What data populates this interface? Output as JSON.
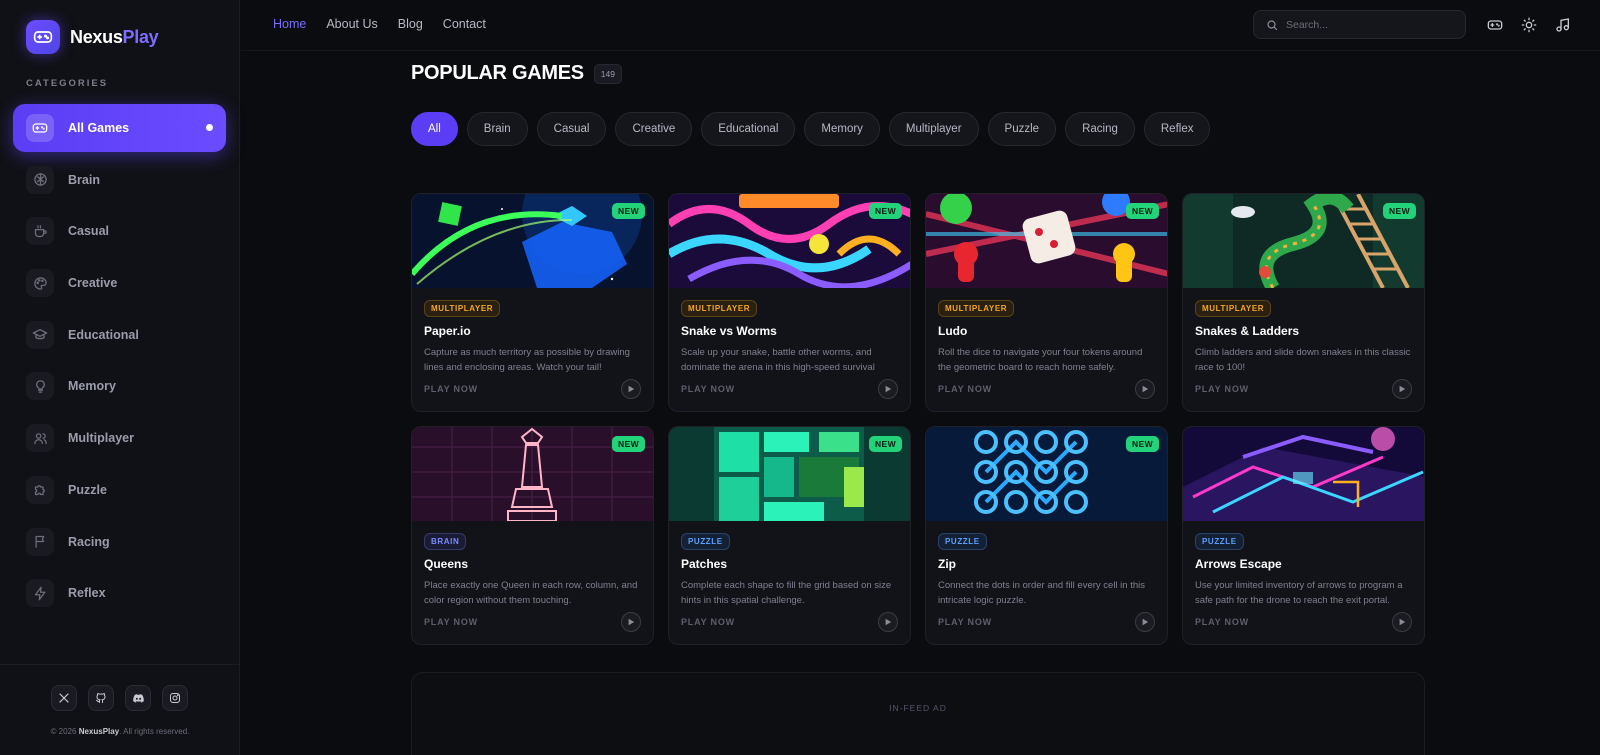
{
  "brand": {
    "name_part1": "Nexus",
    "name_part2": "Play",
    "accent": "#7c6cff"
  },
  "sidebar": {
    "heading": "CATEGORIES",
    "items": [
      {
        "label": "All Games",
        "icon": "gamepad-icon",
        "active": true
      },
      {
        "label": "Brain",
        "icon": "brain-icon"
      },
      {
        "label": "Casual",
        "icon": "coffee-icon"
      },
      {
        "label": "Creative",
        "icon": "palette-icon"
      },
      {
        "label": "Educational",
        "icon": "graduation-cap-icon"
      },
      {
        "label": "Memory",
        "icon": "lightbulb-icon"
      },
      {
        "label": "Multiplayer",
        "icon": "users-icon"
      },
      {
        "label": "Puzzle",
        "icon": "puzzle-icon"
      },
      {
        "label": "Racing",
        "icon": "flag-icon"
      },
      {
        "label": "Reflex",
        "icon": "lightning-icon"
      }
    ],
    "socials": [
      "x-icon",
      "github-icon",
      "discord-icon",
      "instagram-icon"
    ],
    "copyright_prefix": "© 2026 ",
    "copyright_brand": "NexusPlay",
    "copyright_suffix": ". All rights reserved."
  },
  "topbar": {
    "nav": [
      {
        "label": "Home",
        "active": true
      },
      {
        "label": "About Us"
      },
      {
        "label": "Blog"
      },
      {
        "label": "Contact"
      }
    ],
    "search_placeholder": "Search...",
    "icons": [
      "gamepad-icon",
      "sun-icon",
      "music-icon"
    ]
  },
  "main": {
    "title": "POPULAR GAMES",
    "count": "149",
    "filters": [
      "All",
      "Brain",
      "Casual",
      "Creative",
      "Educational",
      "Memory",
      "Multiplayer",
      "Puzzle",
      "Racing",
      "Reflex"
    ],
    "active_filter": "All",
    "play_label": "PLAY NOW",
    "new_label": "NEW",
    "games": [
      {
        "title": "Paper.io",
        "tag": "MULTIPLAYER",
        "tag_type": "multiplayer",
        "is_new": true,
        "desc": "Capture as much territory as possible by drawing lines and enclosing areas. Watch your tail!"
      },
      {
        "title": "Snake vs Worms",
        "tag": "MULTIPLAYER",
        "tag_type": "multiplayer",
        "is_new": true,
        "desc": "Scale up your snake, battle other worms, and dominate the arena in this high-speed survival game!"
      },
      {
        "title": "Ludo",
        "tag": "MULTIPLAYER",
        "tag_type": "multiplayer",
        "is_new": true,
        "desc": "Roll the dice to navigate your four tokens around the geometric board to reach home safely."
      },
      {
        "title": "Snakes & Ladders",
        "tag": "MULTIPLAYER",
        "tag_type": "multiplayer",
        "is_new": true,
        "desc": "Climb ladders and slide down snakes in this classic race to 100!"
      },
      {
        "title": "Queens",
        "tag": "BRAIN",
        "tag_type": "brain",
        "is_new": true,
        "desc": "Place exactly one Queen in each row, column, and color region without them touching."
      },
      {
        "title": "Patches",
        "tag": "PUZZLE",
        "tag_type": "puzzle",
        "is_new": true,
        "desc": "Complete each shape to fill the grid based on size hints in this spatial challenge."
      },
      {
        "title": "Zip",
        "tag": "PUZZLE",
        "tag_type": "puzzle",
        "is_new": true,
        "desc": "Connect the dots in order and fill every cell in this intricate logic puzzle."
      },
      {
        "title": "Arrows Escape",
        "tag": "PUZZLE",
        "tag_type": "puzzle",
        "is_new": false,
        "desc": "Use your limited inventory of arrows to program a safe path for the drone to reach the exit portal. Avoi..."
      }
    ],
    "ad_label": "IN-FEED AD"
  }
}
